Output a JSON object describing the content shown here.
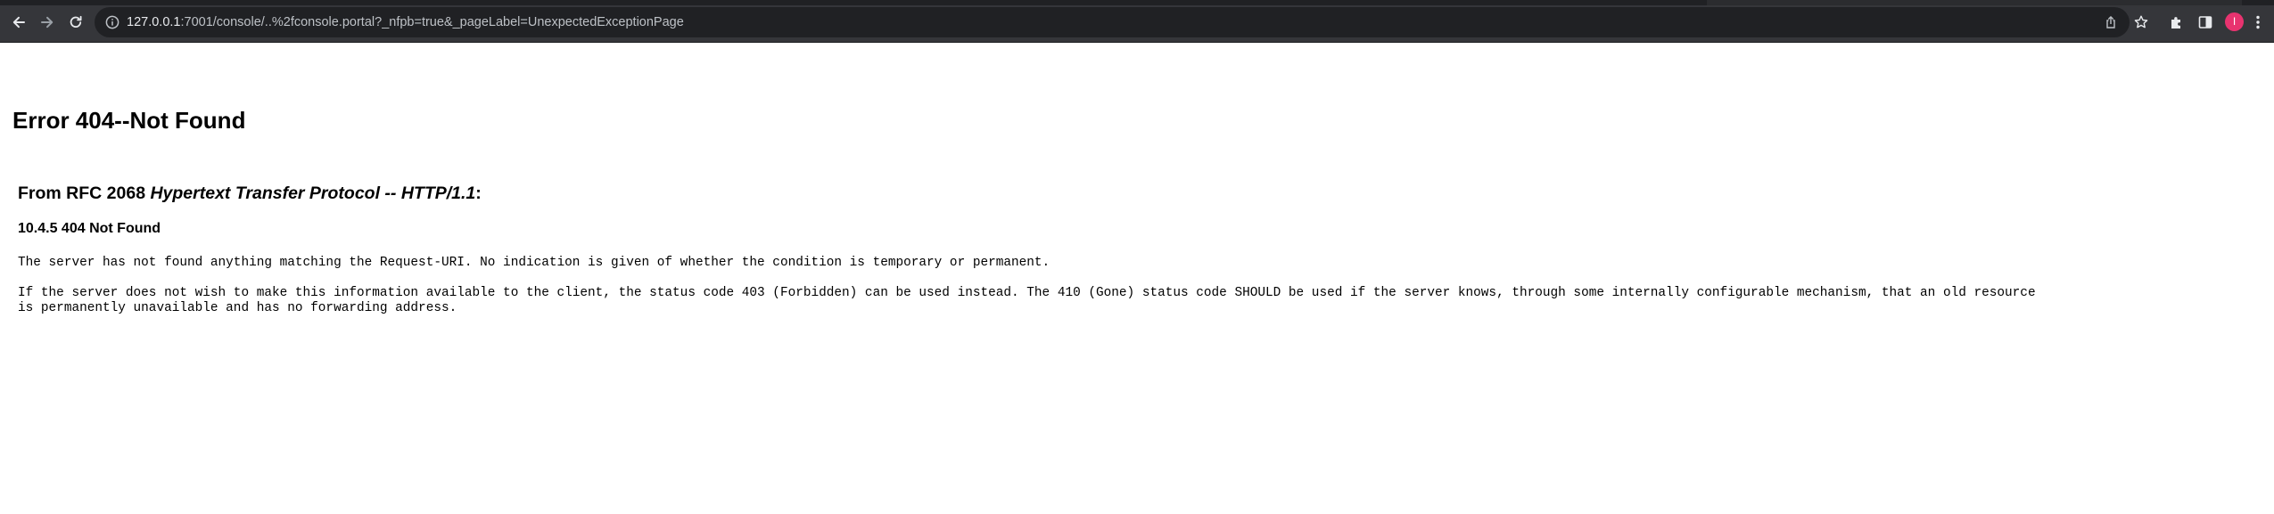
{
  "browser": {
    "url_host": "127.0.0.1",
    "url_rest": ":7001/console/..%2fconsole.portal?_nfpb=true&_pageLabel=UnexpectedExceptionPage",
    "profile_initial": "I",
    "icons": {
      "back": "arrow-left-icon",
      "forward": "arrow-right-icon",
      "reload": "reload-icon",
      "site_info": "info-icon",
      "share": "share-icon",
      "bookmark": "star-icon",
      "extensions": "puzzle-icon",
      "side_panel": "side-panel-icon",
      "menu": "kebab-menu-icon"
    },
    "colors": {
      "toolbar": "#35363a",
      "omnibox": "#202124",
      "avatar": "#e8336f"
    }
  },
  "page": {
    "title": "Error 404--Not Found",
    "rfc_prefix": "From RFC 2068 ",
    "rfc_title": "Hypertext Transfer Protocol -- HTTP/1.1",
    "rfc_suffix": ":",
    "status_heading": "10.4.5 404 Not Found",
    "paragraph_1": "The server has not found anything matching the Request-URI. No indication is given of whether the condition is temporary or permanent.",
    "paragraph_2_line_1": "If the server does not wish to make this information available to the client, the status code 403 (Forbidden) can be used instead. The 410 (Gone) status code SHOULD be used if the server knows, through some internally configurable mechanism, that an old resource",
    "paragraph_2_line_2": "is permanently unavailable and has no forwarding address."
  }
}
